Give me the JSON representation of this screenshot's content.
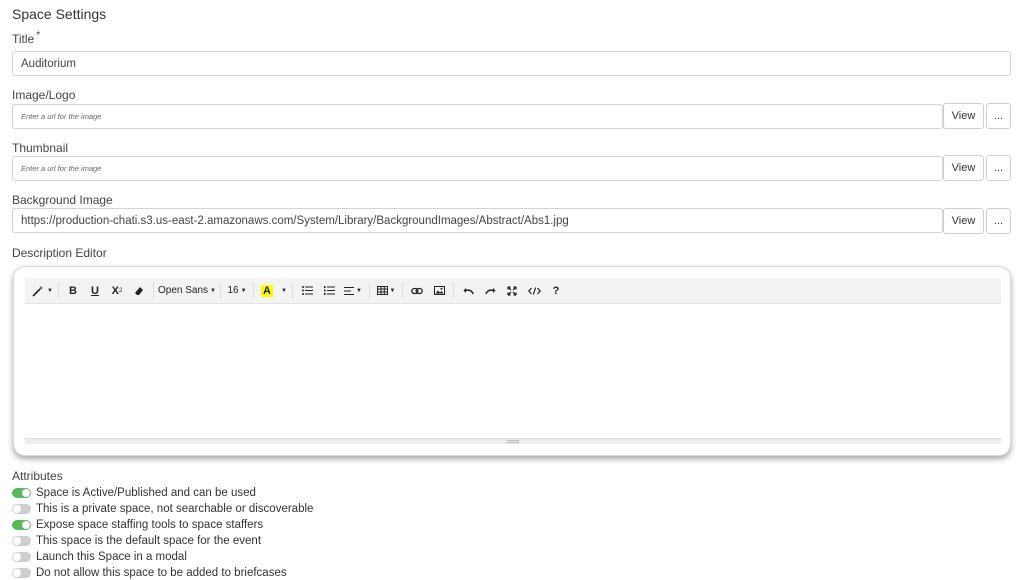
{
  "page": {
    "heading": "Space Settings"
  },
  "fields": {
    "title": {
      "label": "Title",
      "required_marker": "*",
      "value": "Auditorium"
    },
    "image_logo": {
      "label": "Image/Logo",
      "placeholder": "Enter a url for the image",
      "view_label": "View",
      "browse_label": "..."
    },
    "thumbnail": {
      "label": "Thumbnail",
      "placeholder": "Enter a url for the image",
      "view_label": "View",
      "browse_label": "..."
    },
    "background_image": {
      "label": "Background Image",
      "value": "https://production-chati.s3.us-east-2.amazonaws.com/System/Library/BackgroundImages/Abstract/Abs1.jpg",
      "view_label": "View",
      "browse_label": "..."
    }
  },
  "editor": {
    "label": "Description Editor",
    "toolbar": {
      "bold": "B",
      "underline": "U",
      "superscript": "X",
      "font_family": "Open Sans",
      "font_size": "16",
      "font_color": "A",
      "help": "?"
    },
    "content": ""
  },
  "attributes": {
    "title": "Attributes",
    "items": [
      {
        "label": "Space is Active/Published and can be used",
        "on": true
      },
      {
        "label": "This is a private space, not searchable or discoverable",
        "on": false
      },
      {
        "label": "Expose space staffing tools to space staffers",
        "on": true
      },
      {
        "label": "This space is the default space for the event",
        "on": false
      },
      {
        "label": "Launch this Space in a modal",
        "on": false
      },
      {
        "label": "Do not allow this space to be added to briefcases",
        "on": false
      }
    ]
  },
  "colors": {
    "toggle_on": "#5cb85c",
    "toggle_off": "#cfcfcf",
    "font_color_swatch": "#ffff00"
  }
}
